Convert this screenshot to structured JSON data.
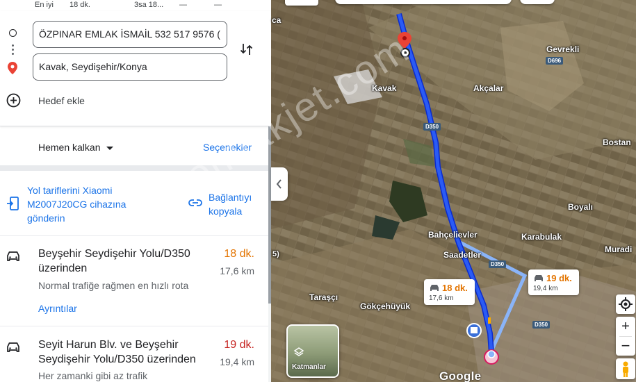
{
  "colors": {
    "accent": "#1a73e8",
    "route_primary": "#1a3ee8",
    "route_alt": "#8ab4f8",
    "time_fast": "#e37400",
    "time_alt": "#c5221f",
    "pin": "#ea4335"
  },
  "mode_row": {
    "label": "En iyi",
    "car_time": "18 dk.",
    "transit_time": "3sa 18...",
    "walk": "—",
    "bike": "—"
  },
  "route_inputs": {
    "origin_value": "ÖZPINAR EMLAK İSMAİL  532 517 9576 (",
    "destination_value": "Kavak, Seydişehir/Konya",
    "add_destination": "Hedef ekle",
    "icons": {
      "origin": "circle-outline-icon",
      "destination": "red-pin-icon",
      "swap": "swap-vertical-icon",
      "add": "add-circle-icon"
    }
  },
  "options": {
    "depart_label": "Hemen kalkan",
    "options_link": "Seçenekler"
  },
  "share": {
    "send_to_device": "Yol tariflerini Xiaomi M2007J20CG cihazına gönderin",
    "copy_link": "Bağlantıyı kopyala"
  },
  "routes": [
    {
      "title": "Beyşehir Seydişehir Yolu/D350 üzerinden",
      "time": "18 dk.",
      "distance": "17,6 km",
      "note": "Normal trafiğe rağmen en hızlı rota",
      "details": "Ayrıntılar"
    },
    {
      "title": "Seyit Harun Blv. ve Beyşehir Seydişehir Yolu/D350 üzerinden",
      "time": "19 dk.",
      "distance": "19,4 km",
      "note": "Her zamanki gibi az trafik"
    }
  ],
  "map": {
    "places": {
      "gevrekli": "Gevrekli",
      "kavak": "Kavak",
      "akcalar": "Akçalar",
      "bostan": "Bostan",
      "boyali": "Boyalı",
      "bahcelievler": "Bahçelievler",
      "karabulak": "Karabulak",
      "saadetler": "Saadetler",
      "muradiye": "Muradi",
      "tarasci": "Taraşçı",
      "gokcehuyuk": "Gökçehüyük",
      "ca": "ca"
    },
    "roads": {
      "d696": "D696",
      "d350_a": "D350",
      "d350_b": "D350",
      "d350_c": "D350",
      "r5": "5)"
    },
    "callouts": [
      {
        "time": "18 dk.",
        "distance": "17,6 km"
      },
      {
        "time": "19 dk.",
        "distance": "19,4 km"
      }
    ],
    "layers_label": "Katmanlar",
    "attribution": "Google",
    "watermark": "emlakjet.com"
  }
}
